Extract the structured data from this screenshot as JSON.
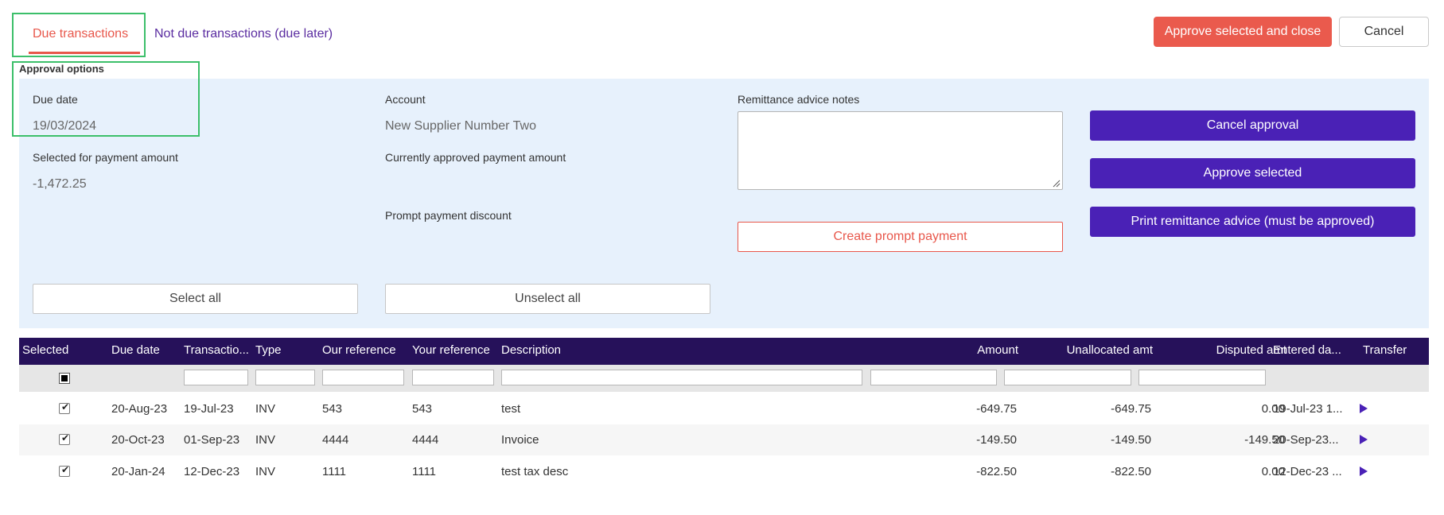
{
  "tabs": {
    "due": "Due transactions",
    "not_due": "Not due transactions (due later)"
  },
  "header_buttons": {
    "approve_close": "Approve selected and close",
    "cancel": "Cancel"
  },
  "approval_options": {
    "title": "Approval options",
    "due_date_label": "Due date",
    "due_date_value": "19/03/2024",
    "account_label": "Account",
    "account_value": "New Supplier Number Two",
    "remittance_label": "Remittance advice notes",
    "remittance_value": "",
    "selected_amount_label": "Selected for payment amount",
    "selected_amount_value": "-1,472.25",
    "currently_approved_label": "Currently approved payment amount",
    "currently_approved_value": "",
    "prompt_discount_label": "Prompt payment discount",
    "prompt_discount_value": "",
    "create_prompt_payment": "Create prompt payment",
    "select_all": "Select all",
    "unselect_all": "Unselect all",
    "cancel_approval": "Cancel approval",
    "approve_selected": "Approve selected",
    "print_remittance": "Print remittance advice (must be approved)"
  },
  "table": {
    "columns": [
      "Selected",
      "Due date",
      "Transactio...",
      "Type",
      "Our reference",
      "Your reference",
      "Description",
      "Amount",
      "Unallocated amt",
      "Disputed amt",
      "Entered da...",
      "Transfer"
    ],
    "rows": [
      {
        "selected": true,
        "due_date": "20-Aug-23",
        "transaction": "19-Jul-23",
        "type": "INV",
        "our_ref": "543",
        "your_ref": "543",
        "description": "test",
        "amount": "-649.75",
        "unallocated": "-649.75",
        "disputed": "0.00",
        "entered": "19-Jul-23 1..."
      },
      {
        "selected": true,
        "due_date": "20-Oct-23",
        "transaction": "01-Sep-23",
        "type": "INV",
        "our_ref": "4444",
        "your_ref": "4444",
        "description": "Invoice",
        "amount": "-149.50",
        "unallocated": "-149.50",
        "disputed": "-149.50",
        "entered": "20-Sep-23..."
      },
      {
        "selected": true,
        "due_date": "20-Jan-24",
        "transaction": "12-Dec-23",
        "type": "INV",
        "our_ref": "1111",
        "your_ref": "1111",
        "description": "test tax desc",
        "amount": "-822.50",
        "unallocated": "-822.50",
        "disputed": "0.00",
        "entered": "12-Dec-23 ..."
      }
    ]
  },
  "colors": {
    "accent_red": "#ea5a4d",
    "accent_purple": "#4a21b6",
    "header_dark": "#26115a",
    "panel_bg": "#e7f1fc",
    "highlight_green": "#3cbf6a"
  }
}
